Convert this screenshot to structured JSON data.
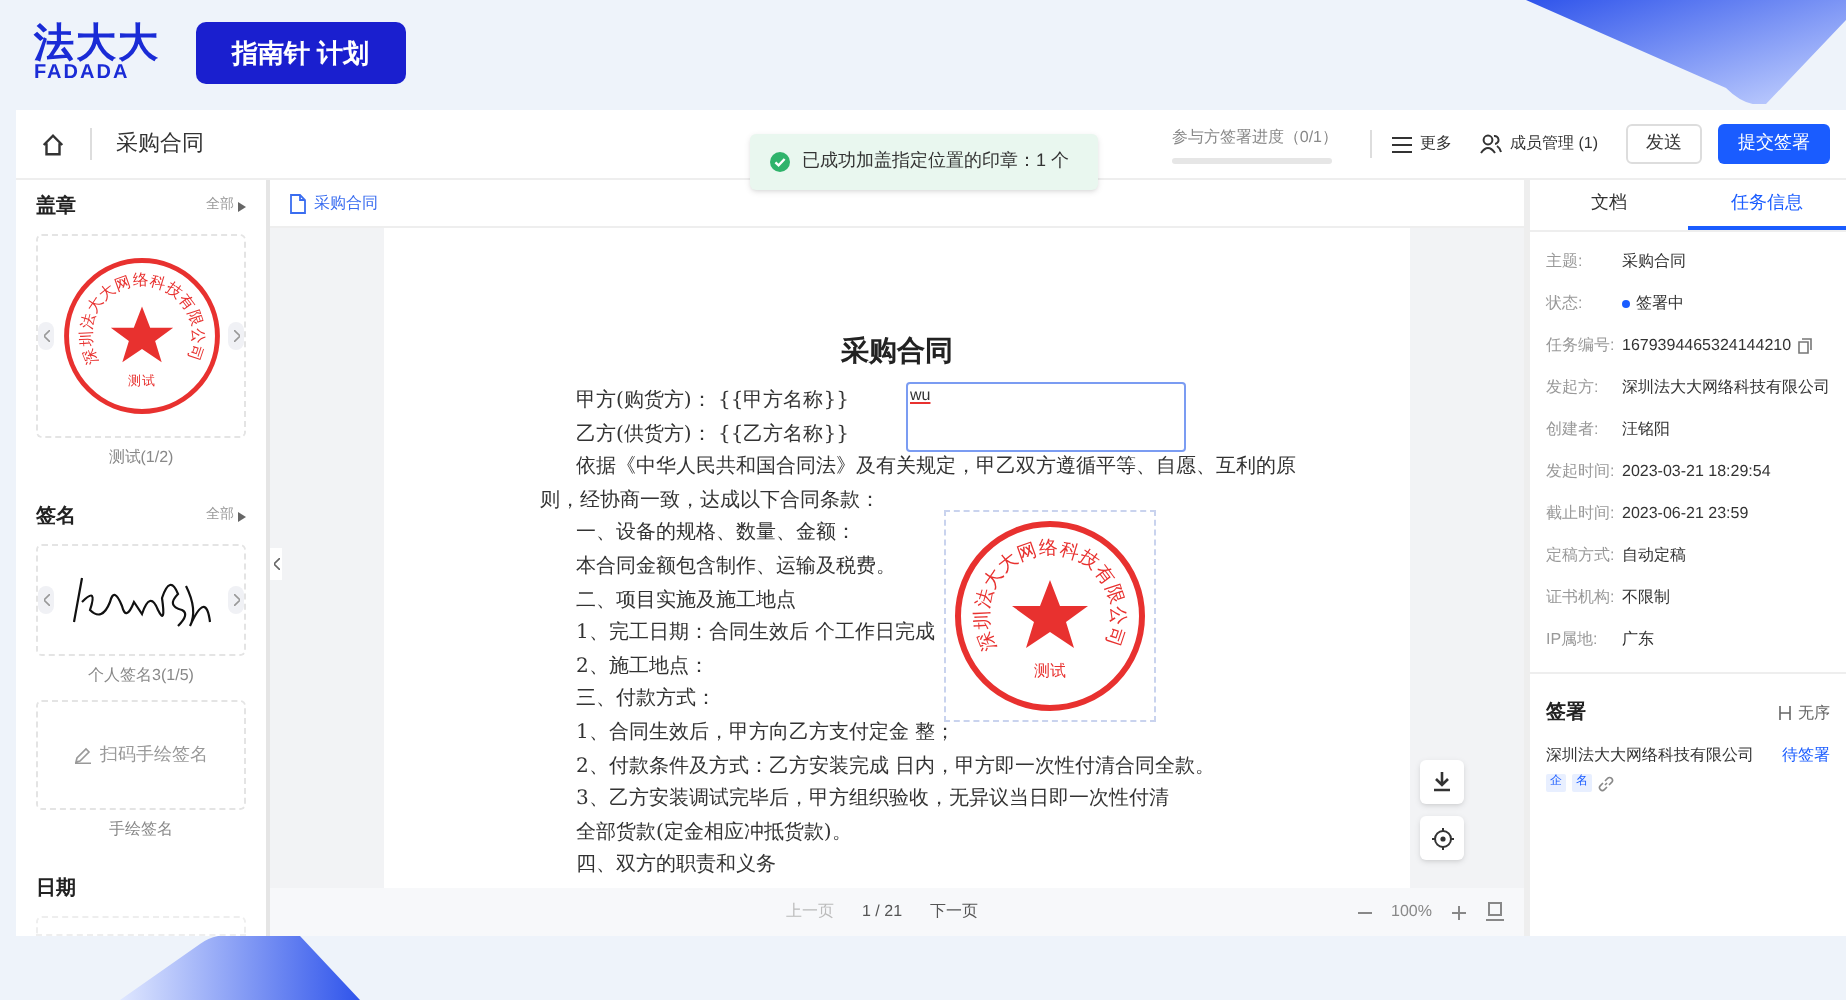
{
  "header": {
    "logo_cn": "法大大",
    "logo_en": "FADADA",
    "badge": "指南针 计划"
  },
  "toolbar": {
    "doc_title": "采购合同",
    "progress": {
      "label": "参与方签署进度（0/1）",
      "level": 0
    },
    "more": "更多",
    "members": "成员管理 (1)",
    "send": "发送",
    "submit": "提交签署"
  },
  "toast": "已成功加盖指定位置的印章：1 个",
  "left_panel": {
    "sections": [
      {
        "title": "盖章",
        "all": "全部",
        "cards": [
          {
            "kind": "seal",
            "company": "深圳法大大网络科技有限公司",
            "name": "测试",
            "caption": "测试(1/2)"
          }
        ]
      },
      {
        "title": "签名",
        "all": "全部",
        "cards": [
          {
            "kind": "signature",
            "caption": "个人签名3(1/5)"
          },
          {
            "kind": "handwrite",
            "action": "扫码手绘签名",
            "caption": "手绘签名"
          }
        ]
      },
      {
        "title": "日期",
        "cards": [
          {
            "kind": "empty"
          }
        ]
      }
    ]
  },
  "document": {
    "tab": "采购合同",
    "title": "采购合同",
    "lines": [
      {
        "kind": "indent",
        "text": "甲方(购货方)：  {{甲方名称}}"
      },
      {
        "kind": "indent",
        "text": "乙方(供货方)：  {{乙方名称}}"
      },
      {
        "kind": "indent",
        "text": "依据《中华人民共和国合同法》及有关规定，甲乙双方遵循平等、自愿、互利的原"
      },
      {
        "kind": "wrap",
        "text": "则，经协商一致，达成以下合同条款："
      },
      {
        "kind": "indent",
        "text": "一、设备的规格、数量、金额："
      },
      {
        "kind": "indent",
        "text": "本合同金额包含制作、运输及税费。"
      },
      {
        "kind": "indent",
        "text": "二、项目实施及施工地点"
      },
      {
        "kind": "indent",
        "text": "1、完工日期：合同生效后 个工作日完成"
      },
      {
        "kind": "indent",
        "text": "2、施工地点："
      },
      {
        "kind": "indent",
        "text": "三、付款方式："
      },
      {
        "kind": "indent",
        "text": "1、合同生效后，甲方向乙方支付定金 整；"
      },
      {
        "kind": "indent",
        "text": "2、付款条件及方式：乙方安装完成 日内，甲方即一次性付清合同全款。"
      },
      {
        "kind": "indent",
        "text": "3、乙方安装调试完毕后，甲方组织验收，无异议当日即一次性付清"
      },
      {
        "kind": "indent",
        "text": "全部货款(定金相应冲抵货款)。"
      },
      {
        "kind": "indent",
        "text": "四、双方的职责和义务"
      }
    ],
    "input_field": {
      "value": "wu"
    },
    "stamp": {
      "company": "深圳法大大网络科技有限公司",
      "name": "测试"
    }
  },
  "pager": {
    "prev": "上一页",
    "prev_disabled": true,
    "page": "1 / 21",
    "next": "下一页",
    "zoom": "100%"
  },
  "right_panel": {
    "tabs": [
      {
        "label": "文档",
        "selected": false
      },
      {
        "label": "任务信息",
        "selected": true
      }
    ],
    "fields": [
      {
        "kind": "text",
        "label": "主题:",
        "value": "采购合同"
      },
      {
        "kind": "status",
        "label": "状态:",
        "value": "签署中"
      },
      {
        "kind": "copy",
        "label": "任务编号:",
        "value": "1679394465324144210"
      },
      {
        "kind": "text",
        "label": "发起方:",
        "value": "深圳法大大网络科技有限公司"
      },
      {
        "kind": "text",
        "label": "创建者:",
        "value": "汪铭阳"
      },
      {
        "kind": "text",
        "label": "发起时间:",
        "value": "2023-03-21 18:29:54"
      },
      {
        "kind": "text",
        "label": "截止时间:",
        "value": "2023-06-21 23:59"
      },
      {
        "kind": "text",
        "label": "定稿方式:",
        "value": "自动定稿"
      },
      {
        "kind": "text",
        "label": "证书机构:",
        "value": "不限制"
      },
      {
        "kind": "text",
        "label": "IP属地:",
        "value": "广东"
      }
    ],
    "signing": {
      "title": "签署",
      "order": "无序",
      "signers": [
        {
          "name": "深圳法大大网络科技有限公司",
          "status": "待签署",
          "tags": [
            "企",
            "名"
          ]
        }
      ]
    }
  }
}
